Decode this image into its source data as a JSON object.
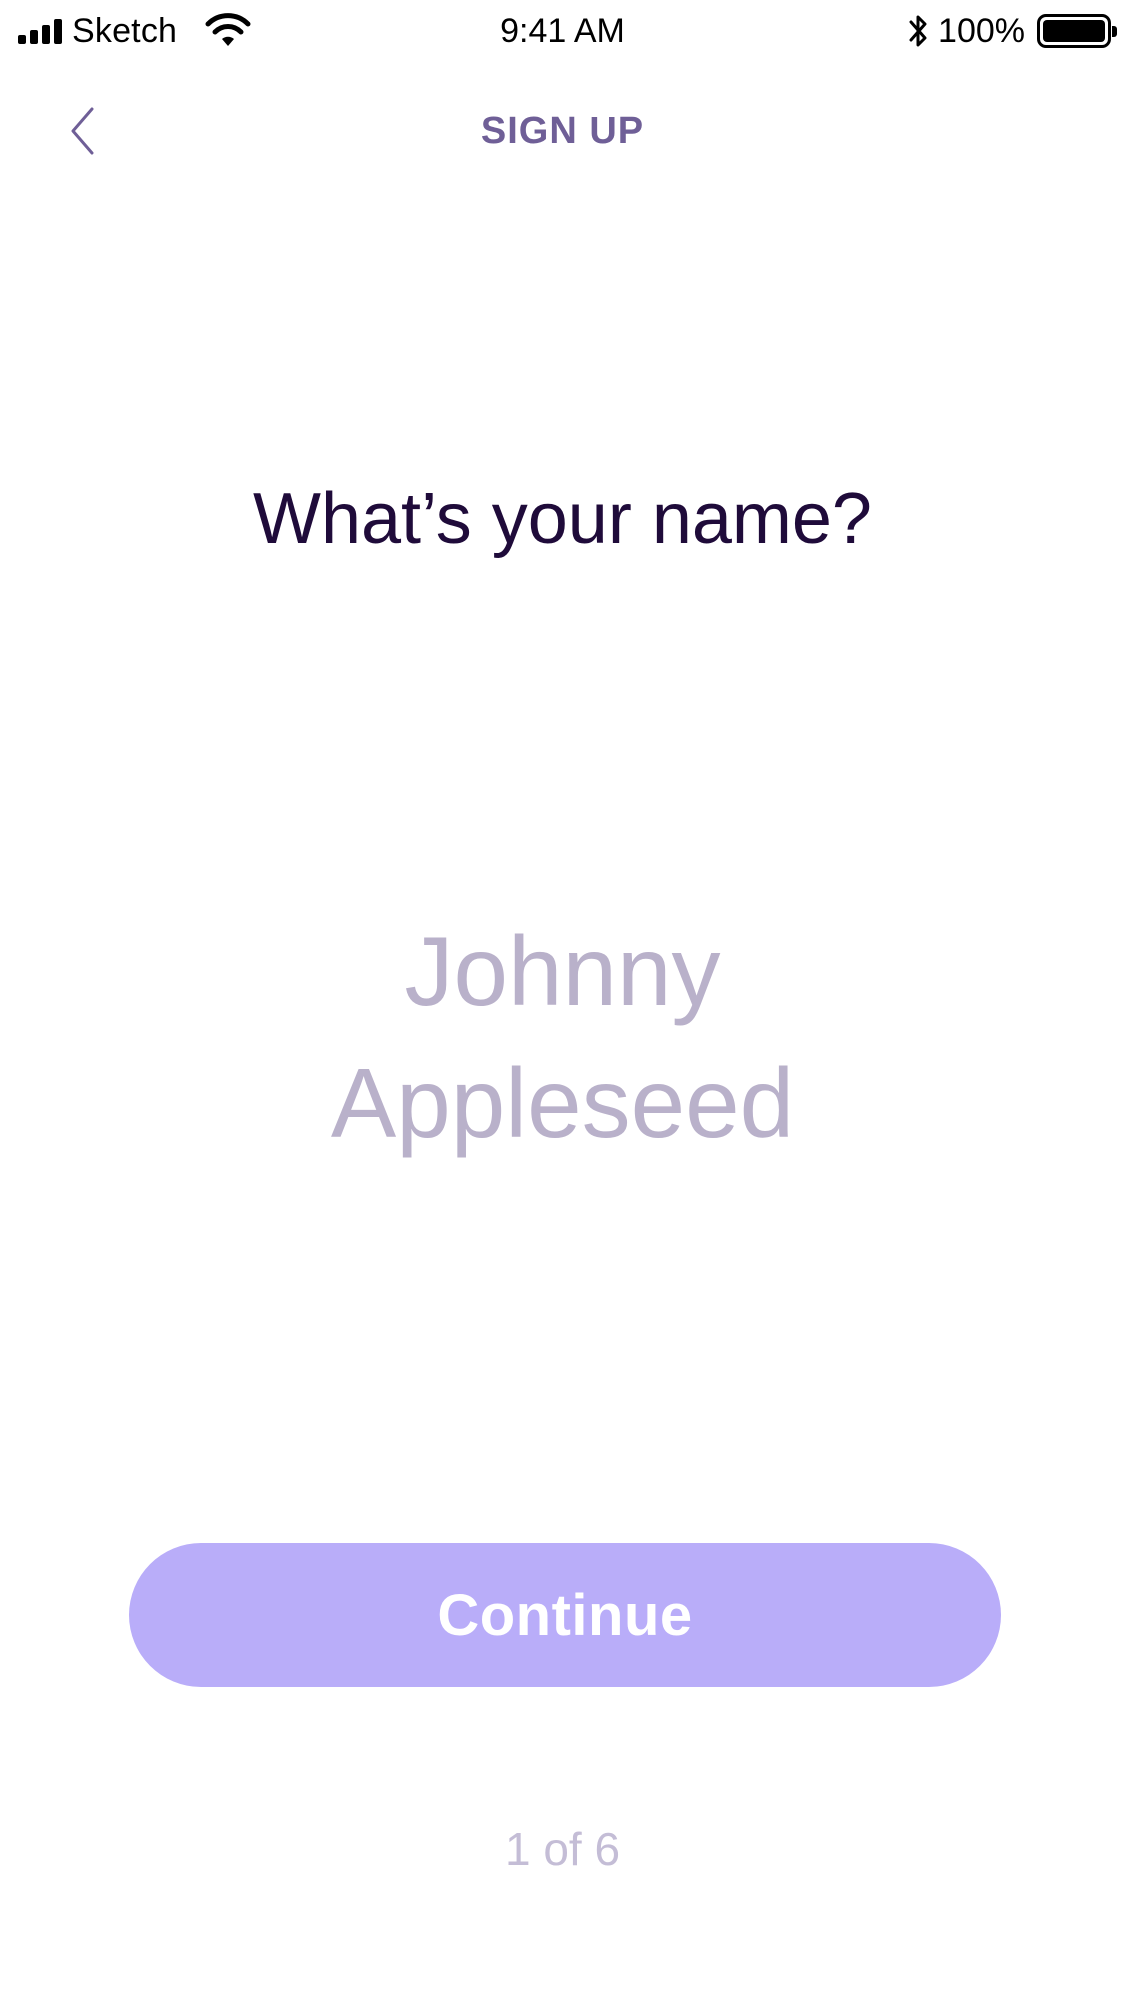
{
  "status_bar": {
    "carrier": "Sketch",
    "time": "9:41 AM",
    "battery_percent": "100%",
    "battery_level": 1.0,
    "icons": [
      "signal-icon",
      "wifi-icon",
      "bluetooth-icon",
      "battery-icon"
    ]
  },
  "nav": {
    "back_icon": "chevron-left-icon",
    "title": "SIGN UP"
  },
  "main": {
    "question": "What’s your name?",
    "name_input": {
      "line1": "Johnny",
      "line2": "Appleseed"
    },
    "continue_label": "Continue",
    "progress": "1 of 6"
  },
  "colors": {
    "title": "#6f5f97",
    "heading": "#1f0b3a",
    "placeholder": "#b9b1ca",
    "button_bg": "#b9adf9",
    "button_text": "#ffffff",
    "progress_text": "#c4bdd6"
  }
}
